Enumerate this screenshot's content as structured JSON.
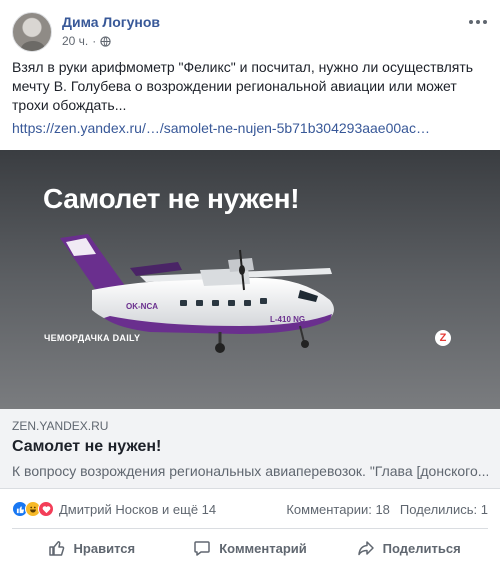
{
  "post": {
    "author": "Дима Логунов",
    "time": "20 ч.",
    "separator": "·",
    "text": "Взял в руки арифмометр \"Феликс\" и посчитал, нужно ли осуществлять мечту В. Голубева о возрождении региональной авиации или может трохи обождать...",
    "link": "https://zen.yandex.ru/…/samolet-ne-nujen-5b71b304293aae00ac…"
  },
  "card": {
    "image_headline": "Самолет не нужен!",
    "image_brand": "ЧЕМОРДАЧКА DAILY",
    "zen_logo_letter": "Z",
    "plane_registration": "OK-NCA",
    "plane_model": "L-410 NG",
    "domain": "ZEN.YANDEX.RU",
    "title": "Самолет не нужен!",
    "description": "К вопросу возрождения региональных авиаперевозок. \"Глава [донского..."
  },
  "reactions": {
    "names": "Дмитрий Носков и ещё 14",
    "comments": "Комментарии: 18",
    "shares": "Поделились: 1",
    "icons": [
      "like-icon",
      "haha-icon",
      "love-icon"
    ]
  },
  "actions": {
    "like": "Нравится",
    "comment": "Комментарий",
    "share": "Поделиться"
  },
  "colors": {
    "link": "#385898",
    "like_blue": "#1877f2",
    "haha_yellow": "#f7b928",
    "love_red": "#f33e58",
    "caption_bg": "#f2f3f5"
  }
}
